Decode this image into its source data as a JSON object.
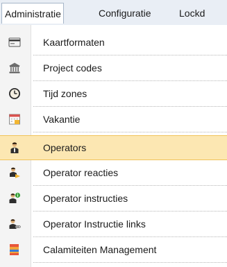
{
  "menubar": {
    "items": [
      {
        "label": "Administratie",
        "active": true
      },
      {
        "label": "Configuratie",
        "active": false
      },
      {
        "label": "Lockd",
        "active": false
      }
    ]
  },
  "dropdown": {
    "items": [
      {
        "label": "Kaartformaten",
        "icon": "card-format-icon",
        "selected": false
      },
      {
        "label": "Project codes",
        "icon": "bank-building-icon",
        "selected": false
      },
      {
        "label": "Tijd zones",
        "icon": "clock-icon",
        "selected": false
      },
      {
        "label": "Vakantie",
        "icon": "calendar-icon",
        "selected": false
      },
      {
        "label": "Operators",
        "icon": "operator-icon",
        "selected": true
      },
      {
        "label": "Operator reacties",
        "icon": "operator-reaction-icon",
        "selected": false
      },
      {
        "label": "Operator instructies",
        "icon": "operator-instruction-icon",
        "selected": false
      },
      {
        "label": "Operator Instructie links",
        "icon": "operator-instruction-link-icon",
        "selected": false
      },
      {
        "label": "Calamiteiten Management",
        "icon": "calamity-management-icon",
        "selected": false
      }
    ]
  },
  "colors": {
    "menubar_bg": "#e9eef5",
    "selected_bg": "#fce7b2",
    "selected_border": "#f0c35a",
    "gutter_bg": "#f4f4f4"
  }
}
